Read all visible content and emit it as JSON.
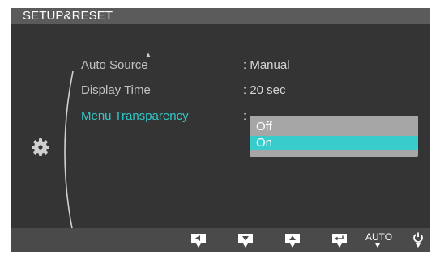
{
  "title": "SETUP&RESET",
  "menu": {
    "scroll_up_icon": "triangle-up-icon",
    "items": [
      {
        "label": "Auto Source",
        "value": ": Manual"
      },
      {
        "label": "Display Time",
        "value": ": 20 sec"
      },
      {
        "label": "Menu Transparency",
        "value": ":"
      }
    ]
  },
  "dropdown": {
    "options": [
      "Off",
      "On"
    ],
    "selected": "On"
  },
  "section_icon": "gear-icon",
  "buttons": {
    "left": "left-arrow-icon",
    "down": "down-arrow-icon",
    "up": "up-arrow-icon",
    "enter": "enter-icon",
    "auto_label": "AUTO",
    "power": "power-icon"
  },
  "colors": {
    "highlight": "#38cccc",
    "selected_text": "#31c7c7"
  }
}
